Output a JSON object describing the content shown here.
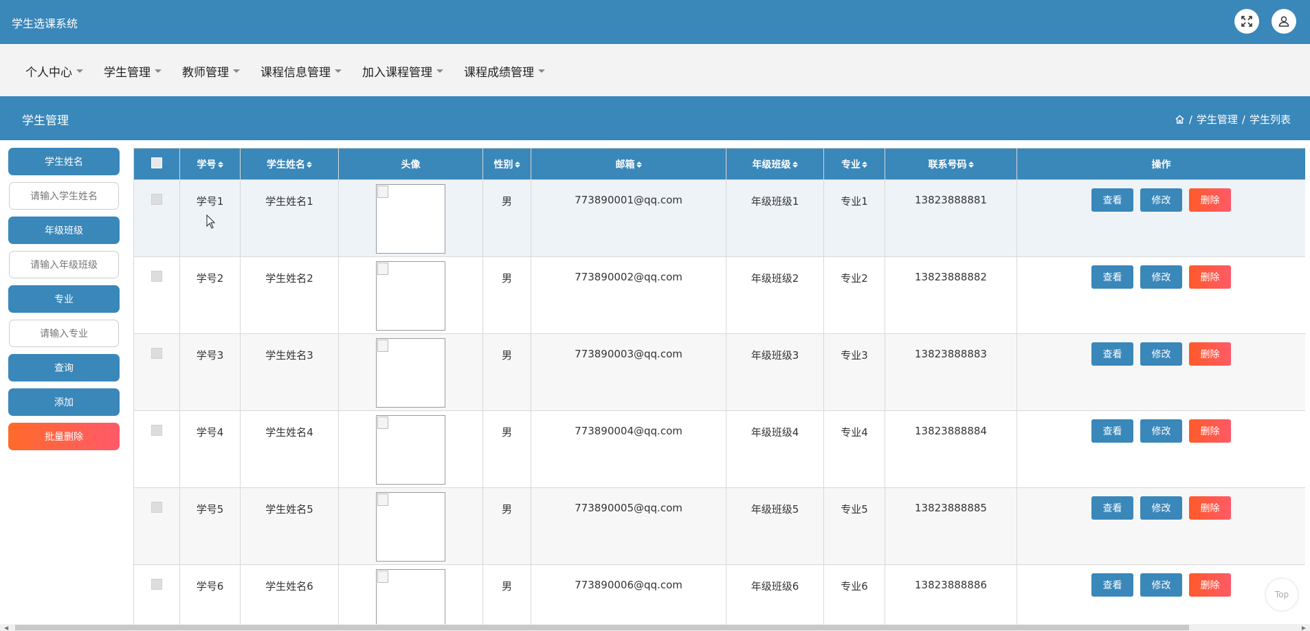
{
  "app": {
    "title": "学生选课系统"
  },
  "header_icons": [
    "fullscreen-icon",
    "user-icon"
  ],
  "nav": {
    "items": [
      {
        "label": "个人中心"
      },
      {
        "label": "学生管理"
      },
      {
        "label": "教师管理"
      },
      {
        "label": "课程信息管理"
      },
      {
        "label": "加入课程管理"
      },
      {
        "label": "课程成绩管理"
      }
    ]
  },
  "page": {
    "title": "学生管理",
    "breadcrumb": [
      "/",
      "学生管理",
      "/",
      "学生列表"
    ]
  },
  "search": {
    "name_label": "学生姓名",
    "name_placeholder": "请输入学生姓名",
    "class_label": "年级班级",
    "class_placeholder": "请输入年级班级",
    "major_label": "专业",
    "major_placeholder": "请输入专业",
    "query_button": "查询",
    "add_button": "添加",
    "batch_delete_button": "批量删除"
  },
  "table": {
    "columns": [
      "学号",
      "学生姓名",
      "头像",
      "性别",
      "邮箱",
      "年级班级",
      "专业",
      "联系号码",
      "操作"
    ],
    "rows": [
      {
        "id": "学号1",
        "name": "学生姓名1",
        "gender": "男",
        "email": "773890001@qq.com",
        "class": "年级班级1",
        "major": "专业1",
        "phone": "13823888881"
      },
      {
        "id": "学号2",
        "name": "学生姓名2",
        "gender": "男",
        "email": "773890002@qq.com",
        "class": "年级班级2",
        "major": "专业2",
        "phone": "13823888882"
      },
      {
        "id": "学号3",
        "name": "学生姓名3",
        "gender": "男",
        "email": "773890003@qq.com",
        "class": "年级班级3",
        "major": "专业3",
        "phone": "13823888883"
      },
      {
        "id": "学号4",
        "name": "学生姓名4",
        "gender": "男",
        "email": "773890004@qq.com",
        "class": "年级班级4",
        "major": "专业4",
        "phone": "13823888884"
      },
      {
        "id": "学号5",
        "name": "学生姓名5",
        "gender": "男",
        "email": "773890005@qq.com",
        "class": "年级班级5",
        "major": "专业5",
        "phone": "13823888885"
      },
      {
        "id": "学号6",
        "name": "学生姓名6",
        "gender": "男",
        "email": "773890006@qq.com",
        "class": "年级班级6",
        "major": "专业6",
        "phone": "13823888886"
      }
    ],
    "actions": {
      "view": "查看",
      "edit": "修改",
      "delete": "删除"
    }
  },
  "back_to_top": "Top",
  "colors": {
    "primary": "#3a87ba",
    "danger": "#ff5a4a",
    "nav_bg": "#f3f3f3"
  }
}
